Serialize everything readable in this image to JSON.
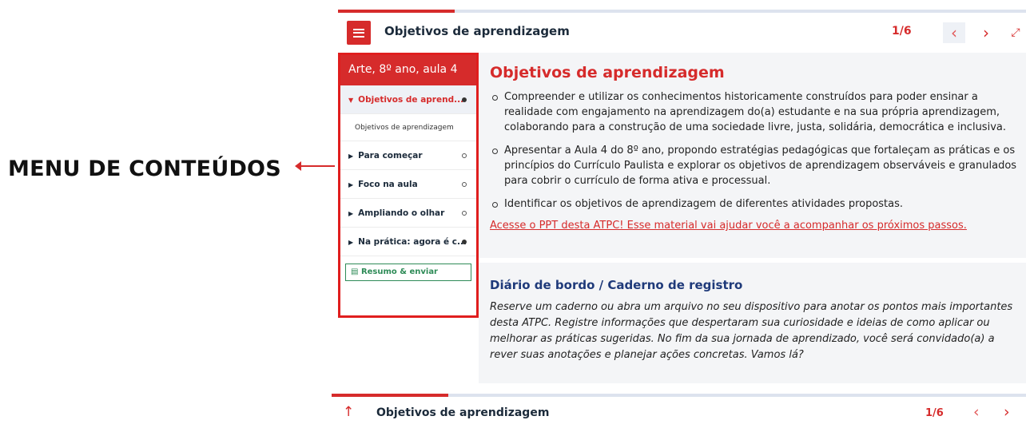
{
  "annotation": {
    "label": "MENU DE CONTEÚDOS"
  },
  "header": {
    "title": "Objetivos de aprendizagem",
    "page_count": "1/6",
    "prev_icon": "‹",
    "next_icon": "›",
    "fullscreen_icon": "⤢"
  },
  "sidebar": {
    "course": "Arte, 8º ano, aula 4",
    "items": [
      {
        "label": "Objetivos de aprend...",
        "expanded": true,
        "completed": true
      },
      {
        "label": "Para começar",
        "expanded": false,
        "completed": false
      },
      {
        "label": "Foco na aula",
        "expanded": false,
        "completed": false
      },
      {
        "label": "Ampliando o olhar",
        "expanded": false,
        "completed": false
      },
      {
        "label": "Na prática: agora é c...",
        "expanded": false,
        "completed": true
      }
    ],
    "subitem": "Objetivos de aprendizagem",
    "resumo": "Resumo & enviar"
  },
  "content": {
    "heading": "Objetivos de aprendizagem",
    "bullets": [
      "Compreender e utilizar os conhecimentos historicamente construídos para poder ensinar a realidade com engajamento na aprendizagem do(a) estudante e na sua própria aprendizagem, colaborando para a construção de uma sociedade livre, justa, solidária, democrática e inclusiva.",
      "Apresentar a Aula 4 do 8º ano, propondo estratégias pedagógicas que fortaleçam as práticas e os princípios do Currículo Paulista e explorar os objetivos de aprendizagem observáveis e granulados para cobrir o currículo de forma ativa e processual.",
      "Identificar os objetivos de aprendizagem de diferentes atividades propostas."
    ],
    "ppt_link": "Acesse o PPT desta ATPC! Esse material vai ajudar você a acompanhar os próximos passos.",
    "diario_heading": "Diário de bordo / Caderno de registro",
    "diario_text": "Reserve um caderno ou abra um arquivo no seu dispositivo para anotar os pontos mais importantes desta ATPC. Registre informações que despertaram sua curiosidade e ideias de como aplicar ou melhorar as práticas sugeridas. No fim da sua jornada de aprendizado, você será convidado(a) a rever suas anotações e planejar ações concretas. Vamos lá?"
  },
  "footer": {
    "title": "Objetivos de aprendizagem",
    "page_count": "1/6",
    "up_icon": "↑",
    "prev_icon": "‹",
    "next_icon": "›"
  },
  "colors": {
    "accent": "#d62b2b",
    "annotation_border": "#e01e1e",
    "link_blue": "#1f3a7a",
    "green": "#2e8b57"
  }
}
